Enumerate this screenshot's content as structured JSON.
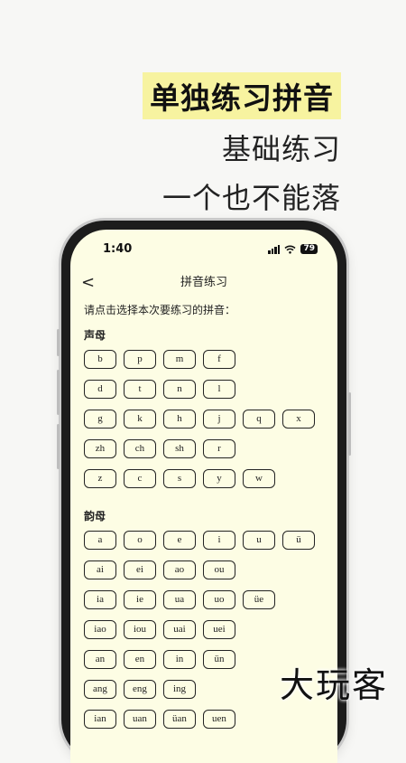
{
  "promo": {
    "line1": "单独练习拼音",
    "line2": "基础练习",
    "line3": "一个也不能落"
  },
  "status": {
    "time": "1:40",
    "battery": "79"
  },
  "nav": {
    "back": "<",
    "title": "拼音练习"
  },
  "instruction": "请点击选择本次要练习的拼音：",
  "initials": {
    "label": "声母",
    "rows": [
      [
        "b",
        "p",
        "m",
        "f"
      ],
      [
        "d",
        "t",
        "n",
        "l"
      ],
      [
        "g",
        "k",
        "h",
        "j",
        "q",
        "x"
      ],
      [
        "zh",
        "ch",
        "sh",
        "r"
      ],
      [
        "z",
        "c",
        "s",
        "y",
        "w"
      ]
    ]
  },
  "finals": {
    "label": "韵母",
    "rows": [
      [
        "a",
        "o",
        "e",
        "i",
        "u",
        "ü"
      ],
      [
        "ai",
        "ei",
        "ao",
        "ou"
      ],
      [
        "ia",
        "ie",
        "ua",
        "uo",
        "üe"
      ],
      [
        "iao",
        "iou",
        "uai",
        "uei"
      ],
      [
        "an",
        "en",
        "in",
        "ün"
      ],
      [
        "ang",
        "eng",
        "ing"
      ],
      [
        "ian",
        "uan",
        "üan",
        "uen"
      ]
    ]
  },
  "watermark": "大玩客"
}
